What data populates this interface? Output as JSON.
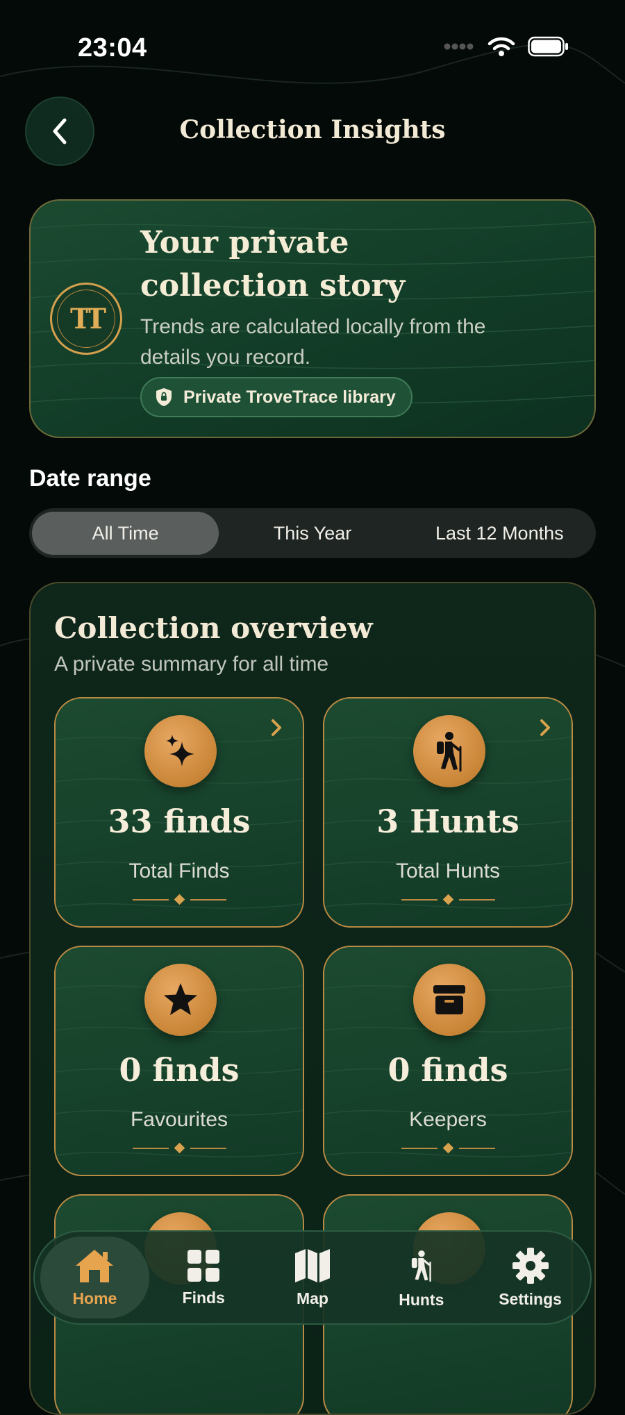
{
  "status_bar": {
    "time": "23:04"
  },
  "header": {
    "title": "Collection Insights"
  },
  "hero": {
    "logo_text": "TT",
    "title_line1": "Your private",
    "title_line2": "collection story",
    "subtitle_line1": "Trends are calculated locally from the",
    "subtitle_line2": "details you record.",
    "badge_label": "Private TroveTrace library"
  },
  "date_range": {
    "label": "Date range",
    "options": [
      "All Time",
      "This Year",
      "Last 12 Months"
    ],
    "selected": "All Time"
  },
  "overview": {
    "title": "Collection overview",
    "subtitle": "A private summary for all time",
    "stats": [
      {
        "icon": "sparkles-icon",
        "value": "33 finds",
        "label": "Total Finds"
      },
      {
        "icon": "hiker-icon",
        "value": "3 Hunts",
        "label": "Total Hunts"
      },
      {
        "icon": "star-icon",
        "value": "0 finds",
        "label": "Favourites"
      },
      {
        "icon": "archive-box-icon",
        "value": "0 finds",
        "label": "Keepers"
      }
    ]
  },
  "tab_bar": {
    "items": [
      {
        "label": "Home",
        "icon": "house-icon",
        "active": true
      },
      {
        "label": "Finds",
        "icon": "grid-icon",
        "active": false
      },
      {
        "label": "Map",
        "icon": "map-icon",
        "active": false
      },
      {
        "label": "Hunts",
        "icon": "hiker-icon",
        "active": false
      },
      {
        "label": "Settings",
        "icon": "gear-icon",
        "active": false
      }
    ]
  },
  "colors": {
    "accent_gold": "#d8a24e",
    "card_green": "#174a31",
    "background": "#040a07"
  }
}
